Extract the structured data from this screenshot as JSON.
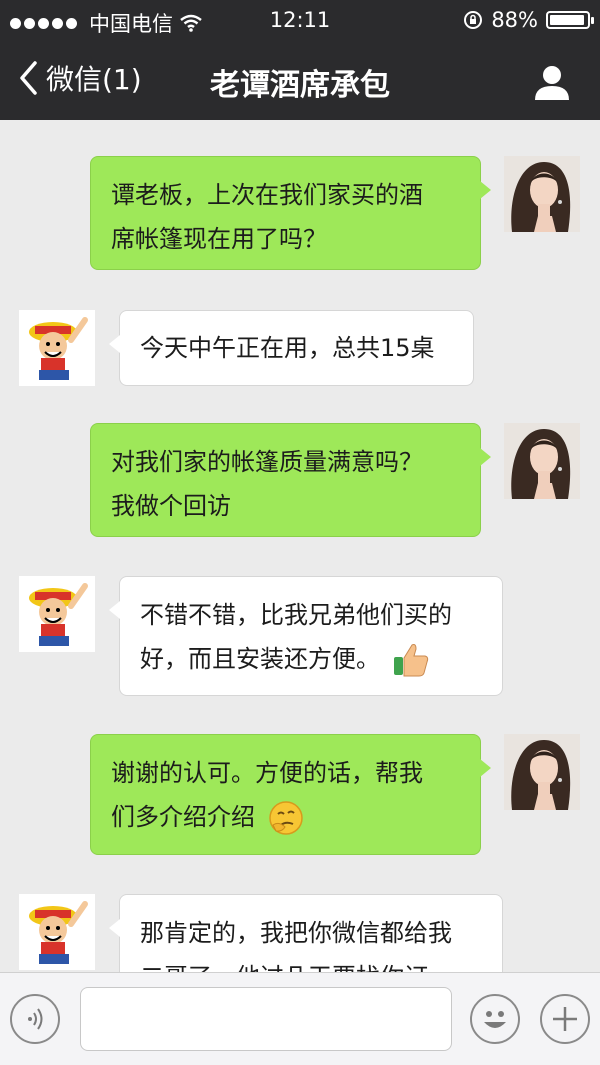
{
  "status_bar": {
    "carrier": "中国电信",
    "time": "12:11",
    "battery": "88%"
  },
  "nav": {
    "back_label": "微信(1)",
    "title": "老谭酒席承包"
  },
  "messages": [
    {
      "side": "right",
      "lines": [
        "谭老板，上次在我们家买的酒",
        "席帐篷现在用了吗？"
      ]
    },
    {
      "side": "left",
      "lines": [
        "今天中午正在用，总共15桌"
      ]
    },
    {
      "side": "right",
      "lines": [
        "对我们家的帐篷质量满意吗？",
        "我做个回访"
      ]
    },
    {
      "side": "left",
      "lines": [
        "不错不错，比我兄弟他们买的",
        "好，而且安装还方便。"
      ],
      "emoji": "thumbs-up-icon"
    },
    {
      "side": "right",
      "lines": [
        "谢谢的认可。方便的话，帮我",
        "们多介绍介绍"
      ],
      "emoji": "thinking-face-icon"
    },
    {
      "side": "left",
      "lines": [
        "那肯定的，我把你微信都给我",
        "二哥了，他过几天要找你订"
      ]
    }
  ],
  "input_bar": {
    "text_value": "",
    "icons": [
      "voice-icon",
      "emoji-icon",
      "plus-icon"
    ]
  }
}
